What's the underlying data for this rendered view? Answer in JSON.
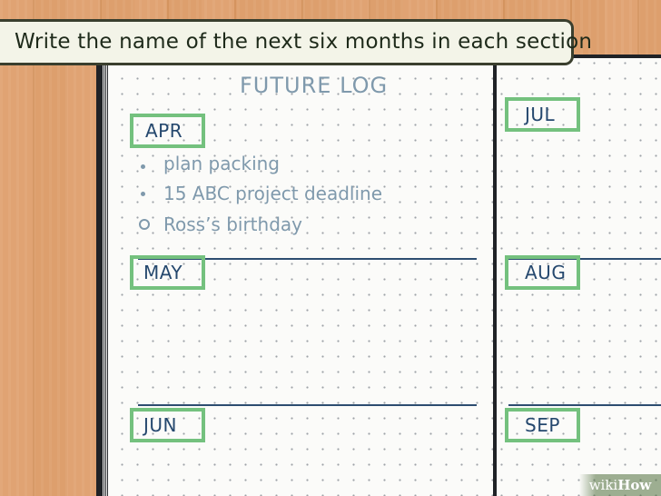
{
  "banner": {
    "text": "Write the name of the next six months in each section"
  },
  "page": {
    "title": "FUTURE LOG",
    "months": {
      "apr": "APR",
      "may": "MAY",
      "jun": "JUN",
      "jul": "JUL",
      "aug": "AUG",
      "sep": "SEP"
    },
    "entries": [
      "plan packing",
      "15 ABC project deadline",
      "Ross’s birthday"
    ]
  },
  "watermark": {
    "light": "wiki",
    "bold": "How"
  },
  "colors": {
    "highlight_box": "#74c17e",
    "month_text": "#25486e",
    "entry_text": "#7f99ac",
    "banner_bg": "#f3f4e8",
    "wood": "#d99a68"
  }
}
